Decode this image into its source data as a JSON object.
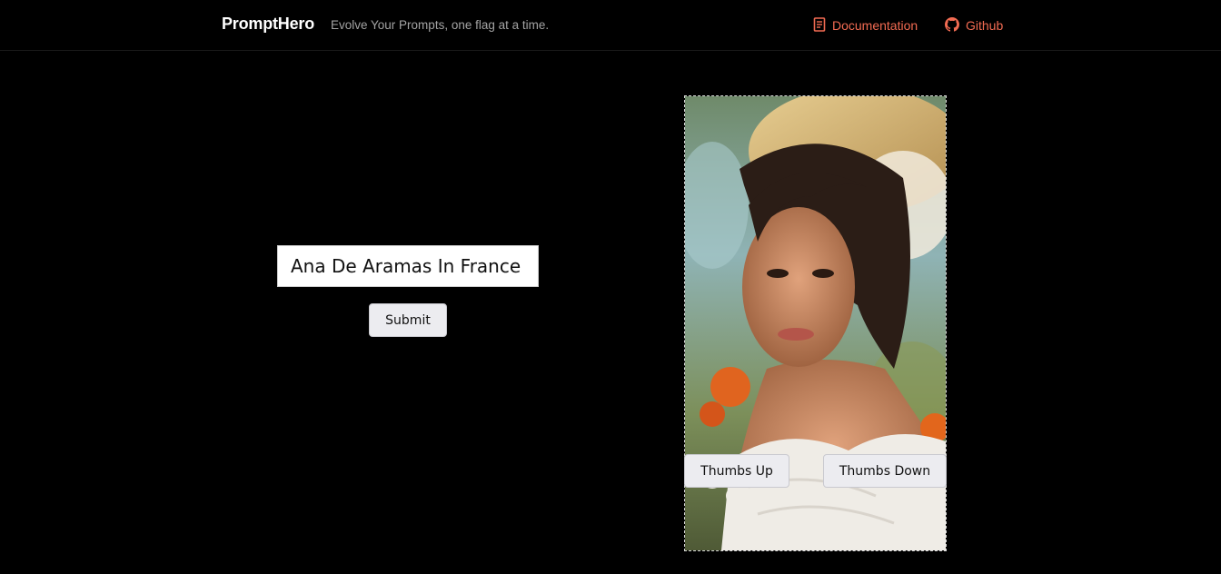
{
  "header": {
    "brand": "PromptHero",
    "tagline": "Evolve Your Prompts, one flag at a time.",
    "nav": [
      {
        "label": "Documentation",
        "icon": "document-icon"
      },
      {
        "label": "Github",
        "icon": "github-icon"
      }
    ],
    "link_color": "#f26b52"
  },
  "prompt": {
    "value": "Ana De Aramas In France"
  },
  "submit_label": "Submit",
  "feedback": {
    "thumbs_up_label": "Thumbs Up",
    "thumbs_down_label": "Thumbs Down"
  }
}
